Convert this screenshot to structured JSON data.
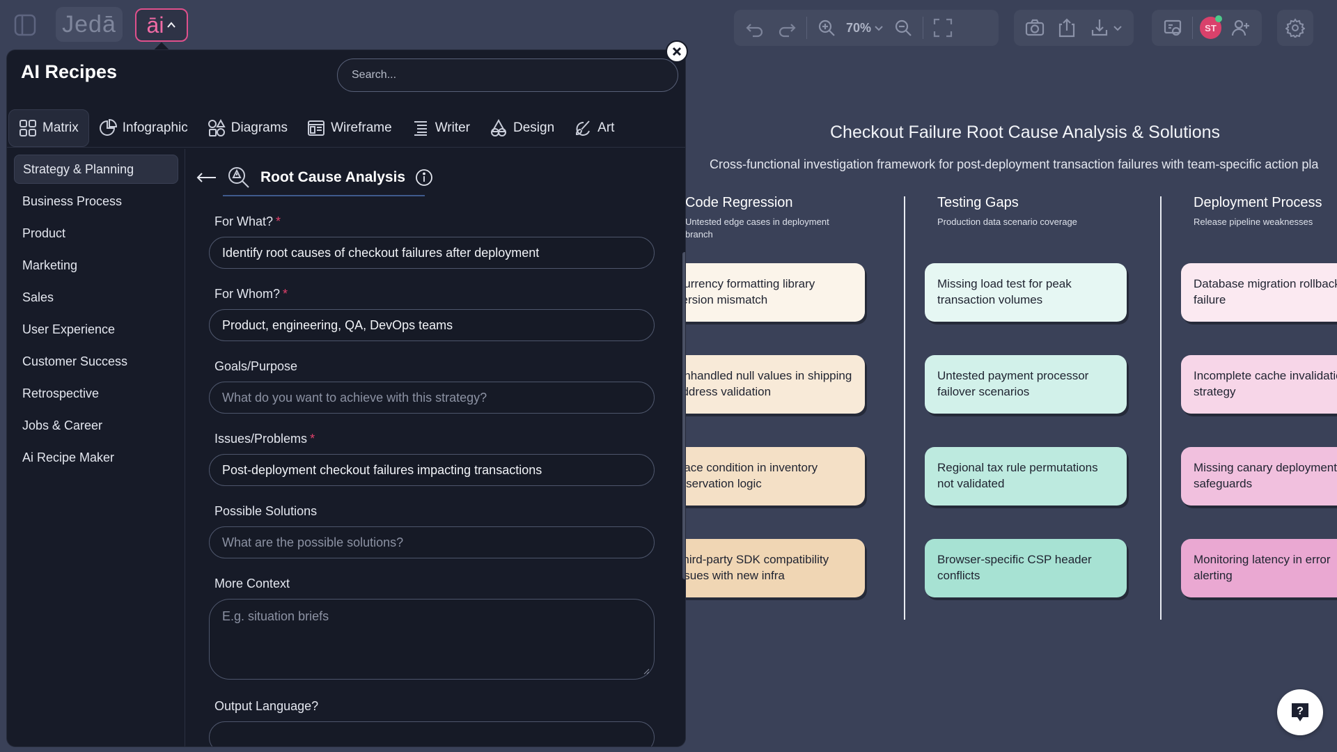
{
  "topbar": {
    "logo": "Jedā",
    "ai_label": "āi",
    "zoom": "70%",
    "avatar_initials": "ST"
  },
  "panel": {
    "title": "AI Recipes",
    "search_placeholder": "Search...",
    "tabs": [
      {
        "label": "Matrix",
        "icon": "grid-icon"
      },
      {
        "label": "Infographic",
        "icon": "pie-chart-icon"
      },
      {
        "label": "Diagrams",
        "icon": "shapes-icon"
      },
      {
        "label": "Wireframe",
        "icon": "wireframe-icon"
      },
      {
        "label": "Writer",
        "icon": "document-icon"
      },
      {
        "label": "Design",
        "icon": "design-icon"
      },
      {
        "label": "Art",
        "icon": "brush-icon"
      }
    ],
    "categories": [
      "Strategy & Planning",
      "Business Process",
      "Product",
      "Marketing",
      "Sales",
      "User Experience",
      "Customer Success",
      "Retrospective",
      "Jobs & Career",
      "Ai Recipe Maker"
    ],
    "recipe_title": "Root Cause Analysis",
    "fields": {
      "for_what": {
        "label": "For What?",
        "value": "Identify root causes of checkout failures after deployment"
      },
      "for_whom": {
        "label": "For Whom?",
        "value": "Product, engineering, QA, DevOps teams"
      },
      "goals": {
        "label": "Goals/Purpose",
        "placeholder": "What do you want to achieve with this strategy?"
      },
      "issues": {
        "label": "Issues/Problems",
        "value": "Post-deployment checkout failures impacting transactions"
      },
      "solutions": {
        "label": "Possible Solutions",
        "placeholder": "What are the possible solutions?"
      },
      "context": {
        "label": "More Context",
        "placeholder": "E.g. situation briefs"
      },
      "language": {
        "label": "Output Language?"
      }
    },
    "required_marker": "*"
  },
  "canvas": {
    "title": "Checkout Failure Root Cause Analysis & Solutions",
    "subtitle": "Cross-functional investigation framework for post-deployment transaction failures with team-specific action pla",
    "columns": [
      {
        "title": "Code Regression",
        "subtitle": "Untested edge cases in deployment branch",
        "cards": [
          "Currency formatting library version mismatch",
          "Unhandled null values in shipping address validation",
          "Race condition in inventory reservation logic",
          "Third-party SDK compatibility issues with new infra"
        ]
      },
      {
        "title": "Testing Gaps",
        "subtitle": "Production data scenario coverage",
        "cards": [
          "Missing load test for peak transaction volumes",
          "Untested payment processor failover scenarios",
          "Regional tax rule permutations not validated",
          "Browser-specific CSP header conflicts"
        ]
      },
      {
        "title": "Deployment Process",
        "subtitle": "Release pipeline weaknesses",
        "cards": [
          "Database migration rollback failure",
          "Incomplete cache invalidation strategy",
          "Missing canary deployment safeguards",
          "Monitoring latency in error alerting"
        ]
      }
    ],
    "colors": {
      "col1": [
        "#fbf4ea",
        "#f8ead8",
        "#f4e0c6",
        "#f0d6b4"
      ],
      "col2": [
        "#e6f7f3",
        "#d2f1ea",
        "#bdeadf",
        "#a7e2d3"
      ],
      "col3": [
        "#fbe9f1",
        "#f7d6e8",
        "#f1c0de",
        "#eaa8d2"
      ]
    }
  }
}
